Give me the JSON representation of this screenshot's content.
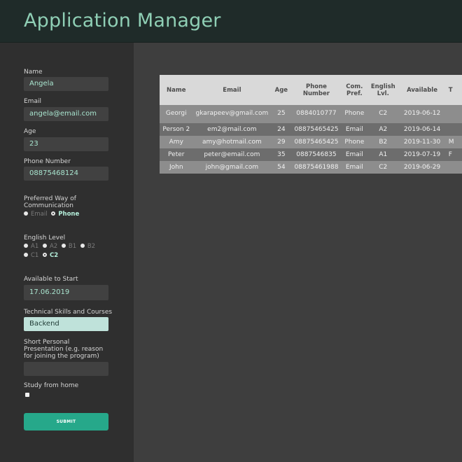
{
  "header": {
    "title": "Application Manager"
  },
  "form": {
    "name": {
      "label": "Name",
      "value": "Angela"
    },
    "email": {
      "label": "Email",
      "value": "angela@email.com"
    },
    "age": {
      "label": "Age",
      "value": "23"
    },
    "phone": {
      "label": "Phone Number",
      "value": "08875468124"
    },
    "communication": {
      "label": "Preferred Way of Communication",
      "options": [
        {
          "label": "Email",
          "selected": false
        },
        {
          "label": "Phone",
          "selected": true
        }
      ]
    },
    "english": {
      "label": "English Level",
      "options": [
        {
          "label": "A1",
          "selected": false
        },
        {
          "label": "A2",
          "selected": false
        },
        {
          "label": "B1",
          "selected": false
        },
        {
          "label": "B2",
          "selected": false
        },
        {
          "label": "C1",
          "selected": false
        },
        {
          "label": "C2",
          "selected": true
        }
      ]
    },
    "start": {
      "label": "Available to Start",
      "value": "17.06.2019"
    },
    "skills": {
      "label": "Technical Skills and Courses",
      "value": "Backend"
    },
    "presentation": {
      "label": "Short Personal Presentation (e.g. reason for joining the program)",
      "value": ""
    },
    "home": {
      "label": "Study from home",
      "checked": false
    },
    "submit_label": "SUBMIT"
  },
  "table": {
    "headers": [
      "Name",
      "Email",
      "Age",
      "Phone Number",
      "Com. Pref.",
      "English Lvl.",
      "Available",
      "T"
    ],
    "rows": [
      [
        "Georgi",
        "gkarapeev@gmail.com",
        "25",
        "0884010777",
        "Phone",
        "C2",
        "2019-06-12",
        ""
      ],
      [
        "Person 2",
        "em2@mail.com",
        "24",
        "08875465425",
        "Email",
        "A2",
        "2019-06-14",
        ""
      ],
      [
        "Amy",
        "amy@hotmail.com",
        "29",
        "08875465425",
        "Phone",
        "B2",
        "2019-11-30",
        "M"
      ],
      [
        "Peter",
        "peter@email.com",
        "35",
        "0887546835",
        "Email",
        "A1",
        "2019-07-19",
        "F"
      ],
      [
        "John",
        "john@gmail.com",
        "54",
        "08875461988",
        "Email",
        "C2",
        "2019-06-29",
        ""
      ]
    ]
  }
}
